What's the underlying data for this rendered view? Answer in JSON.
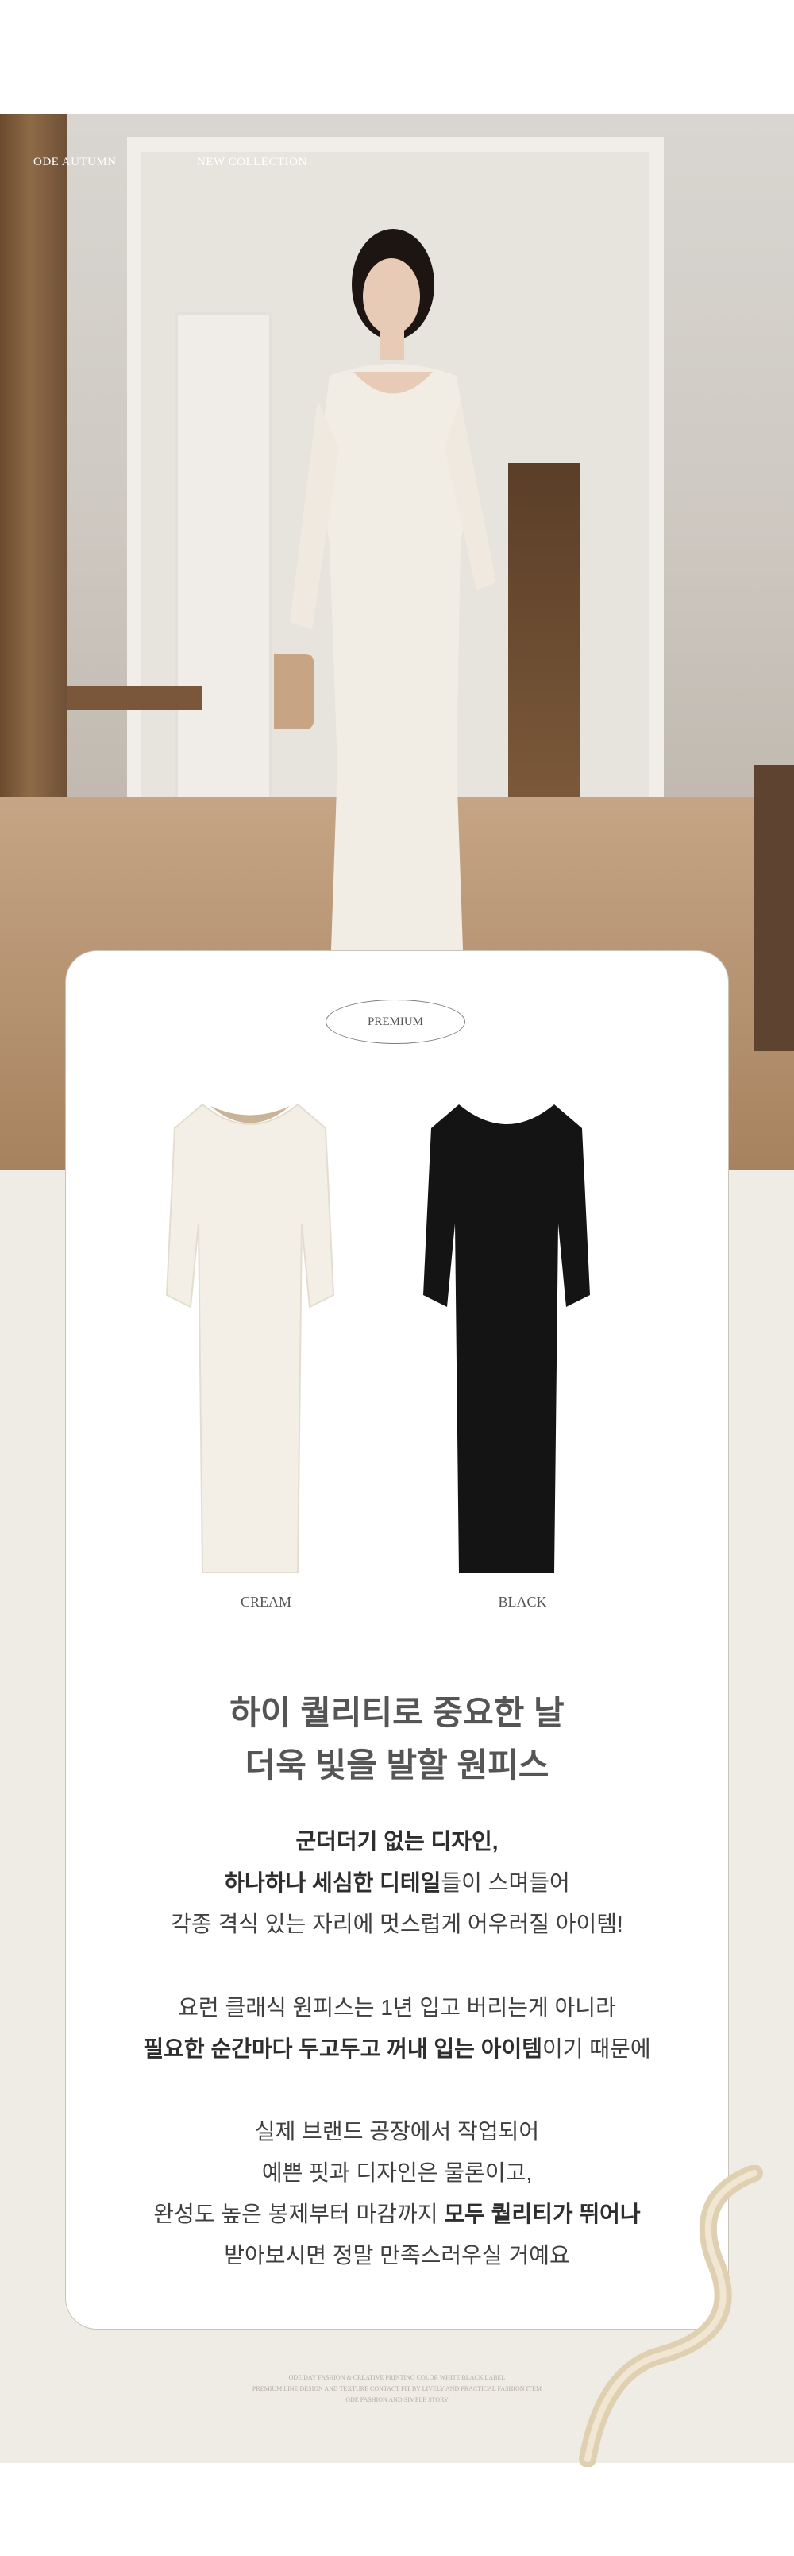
{
  "hero": {
    "brand_label": "ODE AUTUMN",
    "collection_label": "NEW COLLECTION"
  },
  "premium_badge": "PREMIUM",
  "colors": [
    {
      "name": "CREAM",
      "hex": "#f3efe6"
    },
    {
      "name": "BLACK",
      "hex": "#141414"
    }
  ],
  "headline": {
    "line1": "하이 퀄리티로 중요한 날",
    "line2": "더욱 빛을 발할 원피스"
  },
  "description": {
    "p1_l1": "군더더기 없는 디자인,",
    "p1_l2_bold": "하나하나 세심한 디테일",
    "p1_l2_rest": "들이 스며들어",
    "p1_l3": "각종 격식 있는 자리에 멋스럽게 어우러질 아이템!",
    "p2_l1": "요런 클래식 원피스는 1년 입고 버리는게 아니라",
    "p2_l2_bold": "필요한 순간마다 두고두고 꺼내 입는 아이템",
    "p2_l2_rest": "이기 때문에",
    "p3_l1": "실제 브랜드 공장에서 작업되어",
    "p3_l2": "예쁜 핏과 디자인은 물론이고,",
    "p3_l3_pre": "완성도 높은 봉제부터 마감까지 ",
    "p3_l3_bold": "모두 퀄리티가 뛰어나",
    "p3_l4": "받아보시면 정말 만족스러우실 거예요"
  },
  "footer": {
    "fine1": "ODE DAY FASHION & CREATIVE PRINTING COLOR WHITE BLACK LABEL",
    "fine2": "PREMIUM LINE DESIGN AND TEXTURE CONTACT FIT BY LIVELY AND PRACTICAL FASHION ITEM",
    "fine3": "ODE FASHION AND SIMPLE STORY"
  },
  "accent_colors": {
    "beige": "#efece6",
    "text": "#3f3f3f",
    "ribbon": "#dfd0b2"
  }
}
